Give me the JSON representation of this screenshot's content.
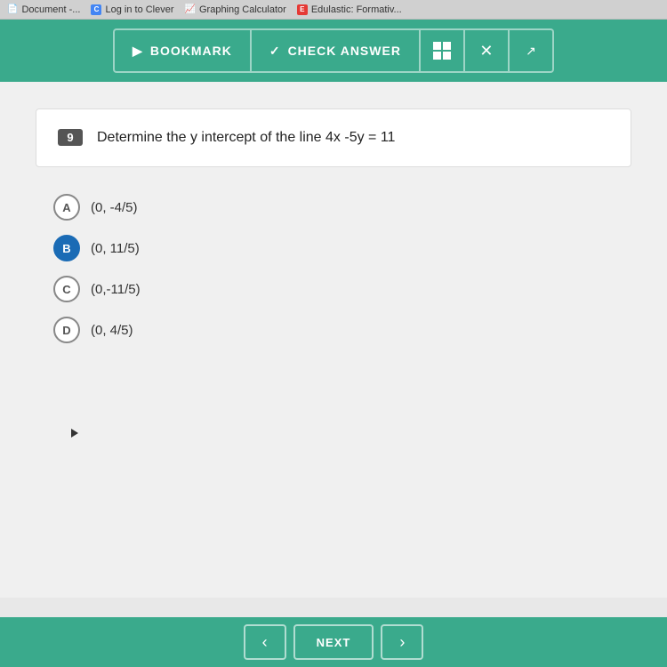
{
  "tabbar": {
    "items": [
      {
        "id": "document",
        "label": "Document -...",
        "favicon": "doc"
      },
      {
        "id": "clever",
        "label": "Log in to Clever",
        "favicon": "C"
      },
      {
        "id": "graphing",
        "label": "Graphing Calculator",
        "favicon": "graph"
      },
      {
        "id": "edulastic",
        "label": "Edulastic: Formativ...",
        "favicon": "E"
      }
    ]
  },
  "toolbar": {
    "bookmark_label": "BOOKMARK",
    "check_answer_label": "CHECK ANSWER",
    "bookmark_icon": "🔖",
    "check_icon": "✓",
    "close_icon": "✕"
  },
  "question": {
    "number": "9",
    "text": "Determine the y intercept of the line 4x -5y = 11"
  },
  "choices": [
    {
      "id": "A",
      "text": "(0, -4/5)",
      "selected": false
    },
    {
      "id": "B",
      "text": "(0, 11/5)",
      "selected": true
    },
    {
      "id": "C",
      "text": "(0,-11/5)",
      "selected": false
    },
    {
      "id": "D",
      "text": "(0, 4/5)",
      "selected": false
    }
  ],
  "bottom_nav": {
    "next_label": "NEXT",
    "prev_arrow": "‹",
    "next_arrow": "›"
  }
}
